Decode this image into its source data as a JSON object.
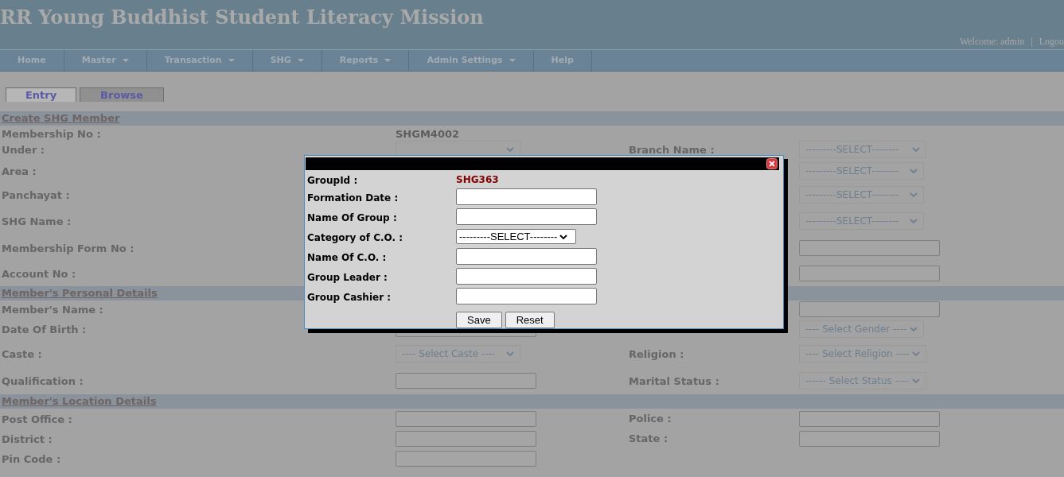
{
  "header": {
    "title": "RR Young Buddhist Student Literacy Mission",
    "welcome": "Welcome: admin",
    "separator": "|",
    "logout": "Logou"
  },
  "menu": [
    {
      "label": "Home",
      "has_dropdown": false
    },
    {
      "label": "Master",
      "has_dropdown": true
    },
    {
      "label": "Transaction",
      "has_dropdown": true
    },
    {
      "label": "SHG",
      "has_dropdown": true
    },
    {
      "label": "Reports",
      "has_dropdown": true
    },
    {
      "label": "Admin Settings",
      "has_dropdown": true
    },
    {
      "label": "Help",
      "has_dropdown": false
    }
  ],
  "tabs": [
    {
      "label": "Entry",
      "selected": true
    },
    {
      "label": "Browse",
      "selected": false
    }
  ],
  "sections": [
    {
      "title": "Create SHG Member",
      "rows": [
        {
          "label": "Membership No :",
          "value": {
            "kind": "text",
            "text": "SHGM4002"
          }
        },
        {
          "label": "Under :",
          "value": {
            "kind": "select"
          },
          "right_label": "Branch Name :",
          "right_value": {
            "kind": "select",
            "text": "---------SELECT--------"
          }
        },
        {
          "label": "Area :",
          "right_value": {
            "kind": "select",
            "text": "---------SELECT--------"
          }
        },
        {
          "label": "Panchayat :",
          "right_value": {
            "kind": "select",
            "text": "---------SELECT--------"
          }
        },
        {
          "label": "SHG Name :",
          "right_value": {
            "kind": "select",
            "text": "---------SELECT--------"
          }
        },
        {
          "label": "Membership Form No :",
          "right_value": {
            "kind": "input"
          }
        },
        {
          "label": "Account No :",
          "right_value": {
            "kind": "input"
          }
        }
      ]
    },
    {
      "title": "Member's Personal Details",
      "rows": [
        {
          "label": "Member's Name :",
          "right_value": {
            "kind": "input"
          }
        },
        {
          "label": "Date Of Birth :",
          "value": {
            "kind": "input"
          },
          "right_value": {
            "kind": "select",
            "text": "---- Select Gender ----"
          }
        },
        {
          "label": "Caste :",
          "value": {
            "kind": "select",
            "text": "---- Select Caste ----"
          },
          "right_label": "Religion :",
          "right_value": {
            "kind": "select",
            "text": "---- Select Religion ----"
          }
        },
        {
          "label": "Qualification :",
          "value": {
            "kind": "input"
          },
          "right_label": "Marital Status :",
          "right_value": {
            "kind": "select",
            "text": "------ Select Status ----"
          }
        }
      ]
    },
    {
      "title": "Member's Location Details",
      "rows": [
        {
          "label": "Post Office :",
          "value": {
            "kind": "input"
          },
          "right_label": "Police :",
          "right_value": {
            "kind": "input"
          }
        },
        {
          "label": "District :",
          "value": {
            "kind": "input"
          },
          "right_label": "State :",
          "right_value": {
            "kind": "input"
          }
        },
        {
          "label": "Pin Code :",
          "value": {
            "kind": "input"
          }
        }
      ]
    }
  ],
  "dialog": {
    "fields": [
      {
        "label": "GroupId :",
        "kind": "text",
        "value": "SHG363"
      },
      {
        "label": "Formation Date :",
        "kind": "input"
      },
      {
        "label": "Name Of Group :",
        "kind": "input"
      },
      {
        "label": "Category of C.O. :",
        "kind": "select",
        "value": "---------SELECT--------"
      },
      {
        "label": "Name Of C.O. :",
        "kind": "input"
      },
      {
        "label": "Group Leader :",
        "kind": "input"
      },
      {
        "label": "Group Cashier :",
        "kind": "input"
      }
    ],
    "buttons": [
      "Save",
      "Reset"
    ]
  }
}
